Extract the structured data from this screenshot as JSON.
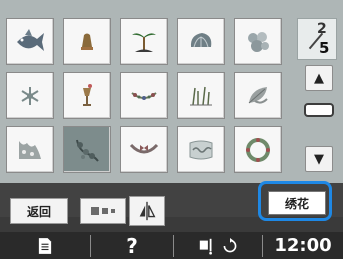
{
  "patterns": [
    {
      "icon": "fish-icon"
    },
    {
      "icon": "bell-icon"
    },
    {
      "icon": "palm-tree-icon"
    },
    {
      "icon": "shell-icon"
    },
    {
      "icon": "coral-icon"
    },
    {
      "icon": "snowflake-icon"
    },
    {
      "icon": "cup-icon"
    },
    {
      "icon": "garland-icon"
    },
    {
      "icon": "grass-icon"
    },
    {
      "icon": "leaf-pattern-icon"
    },
    {
      "icon": "lace-icon"
    },
    {
      "icon": "floral-corner-icon"
    },
    {
      "icon": "bow-swag-icon"
    },
    {
      "icon": "lettering-icon"
    },
    {
      "icon": "wreath-icon"
    }
  ],
  "selected_index": 11,
  "page": {
    "current": "2",
    "total": "5"
  },
  "buttons": {
    "back": "返回",
    "embroider": "绣花"
  },
  "status": {
    "help": "?",
    "time": "12:00"
  },
  "colors": {
    "panel": "#aeb6b6",
    "selected_tile": "#7d8c8c",
    "highlight": "#1e88e5",
    "bottom_bar": "#424242"
  }
}
